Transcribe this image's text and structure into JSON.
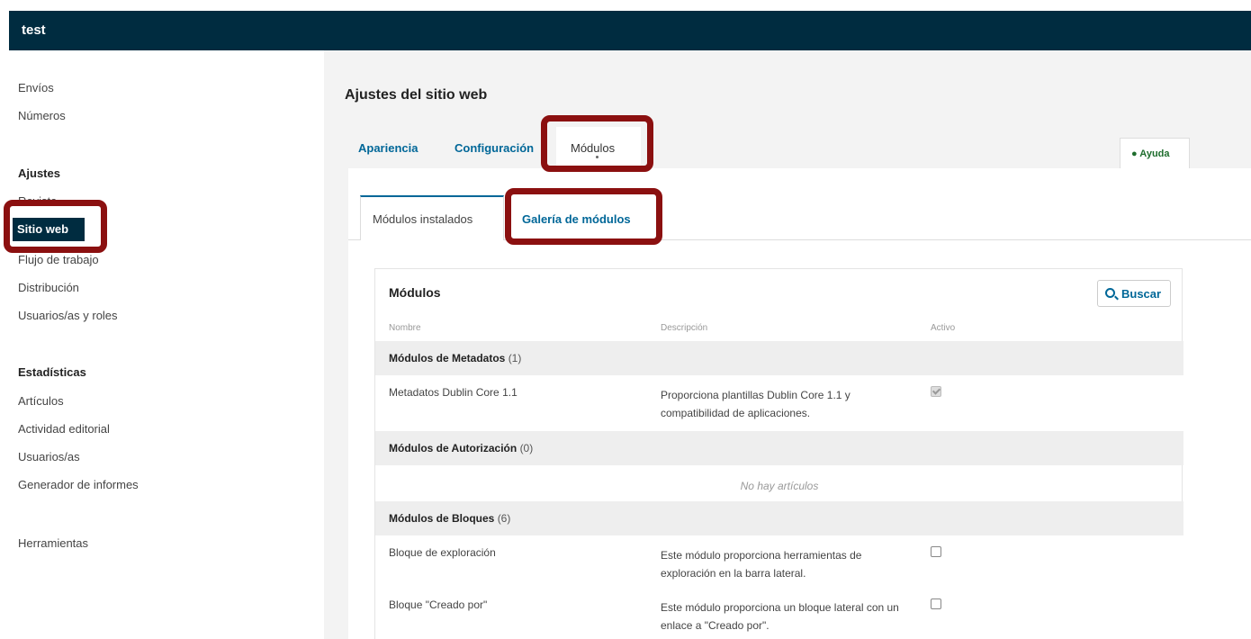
{
  "app": {
    "title": "test"
  },
  "sidebar": {
    "group1": [
      "Envíos",
      "Números"
    ],
    "settings_heading": "Ajustes",
    "settings_items": [
      "Revista",
      "Sitio web",
      "Flujo de trabajo",
      "Distribución",
      "Usuarios/as y roles"
    ],
    "stats_heading": "Estadísticas",
    "stats_items": [
      "Artículos",
      "Actividad editorial",
      "Usuarios/as",
      "Generador de informes"
    ],
    "tools": "Herramientas"
  },
  "main": {
    "page_title": "Ajustes del sitio web",
    "tabs": [
      {
        "label": "Apariencia"
      },
      {
        "label": "Configuración"
      },
      {
        "label": "Módulos"
      }
    ],
    "help_label": "Ayuda",
    "subtabs": [
      {
        "label": "Módulos instalados"
      },
      {
        "label": "Galería de módulos"
      }
    ],
    "card": {
      "title": "Módulos",
      "search_label": "Buscar",
      "columns": [
        "Nombre",
        "Descripción",
        "Activo"
      ],
      "groups": [
        {
          "name": "Módulos de Metadatos",
          "count": "(1)",
          "rows": [
            {
              "name": "Metadatos Dublin Core 1.1",
              "description": "Proporciona plantillas Dublin Core 1.1 y compatibilidad de aplicaciones.",
              "active": true
            }
          ]
        },
        {
          "name": "Módulos de Autorización",
          "count": "(0)",
          "empty": "No hay artículos"
        },
        {
          "name": "Módulos de Bloques",
          "count": "(6)",
          "rows": [
            {
              "name": "Bloque de exploración",
              "description": "Este módulo proporciona herramientas de exploración en la barra lateral.",
              "active": false
            },
            {
              "name": "Bloque \"Creado por\"",
              "description": "Este módulo proporciona un bloque lateral con un enlace a \"Creado por\".",
              "active": false
            }
          ]
        }
      ]
    }
  },
  "colors": {
    "header_bg": "#002c40",
    "link": "#006798",
    "highlight": "#8b1010"
  }
}
